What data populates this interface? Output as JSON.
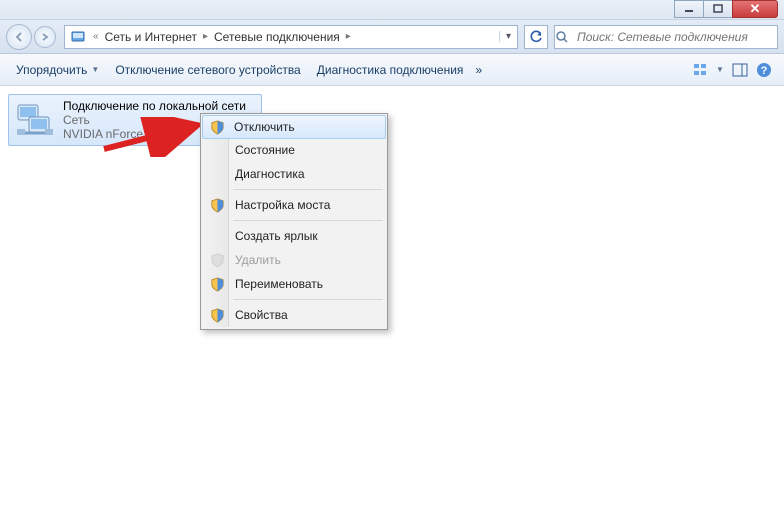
{
  "breadcrumb": {
    "seg1": "Сеть и Интернет",
    "seg2": "Сетевые подключения"
  },
  "search": {
    "placeholder": "Поиск: Сетевые подключения"
  },
  "toolbar": {
    "organize": "Упорядочить",
    "disable_device": "Отключение сетевого устройства",
    "diagnose": "Диагностика подключения"
  },
  "connection": {
    "title": "Подключение по локальной сети",
    "subtitle": "Сеть",
    "adapter": "NVIDIA nForce 10/1…"
  },
  "context_menu": {
    "disable": "Отключить",
    "status": "Состояние",
    "diagnose": "Диагностика",
    "bridge": "Настройка моста",
    "create_shortcut": "Создать ярлык",
    "delete": "Удалить",
    "rename": "Переименовать",
    "properties": "Свойства"
  }
}
